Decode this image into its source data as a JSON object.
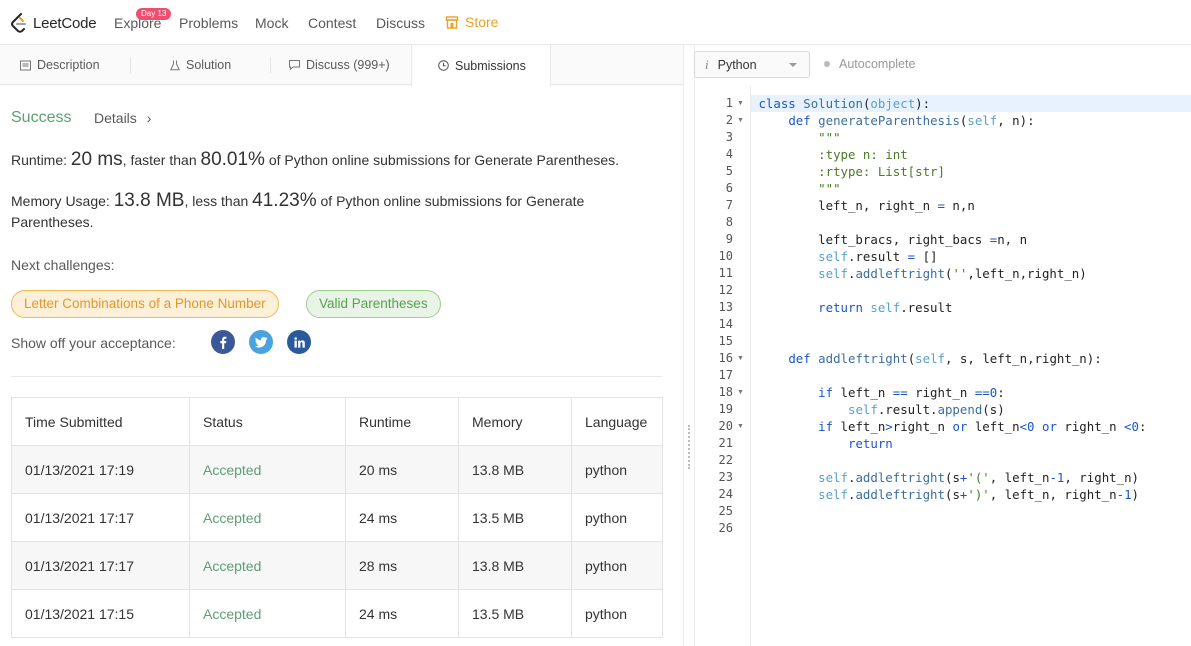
{
  "nav": {
    "logo_text": "LeetCode",
    "items": [
      "Explore",
      "Problems",
      "Mock",
      "Contest",
      "Discuss"
    ],
    "badge": "Day 13",
    "store": "Store"
  },
  "tabs": {
    "description": "Description",
    "solution": "Solution",
    "discuss": "Discuss (999+)",
    "submissions": "Submissions"
  },
  "result": {
    "status": "Success",
    "details": "Details",
    "runtime_label": "Runtime: ",
    "runtime_value": "20 ms",
    "runtime_mid": ", faster than ",
    "runtime_pct": "80.01%",
    "runtime_tail": " of Python online submissions for Generate Parentheses.",
    "memory_label": "Memory Usage: ",
    "memory_value": "13.8 MB",
    "memory_mid": ", less than ",
    "memory_pct": "41.23%",
    "memory_tail": " of Python online submissions for Generate",
    "memory_tail2": "Parentheses."
  },
  "challenges": {
    "label": "Next challenges:",
    "items": [
      "Letter Combinations of a Phone Number",
      "Valid Parentheses"
    ]
  },
  "share": {
    "label": "Show off your acceptance:",
    "icons": [
      "facebook-icon",
      "twitter-icon",
      "linkedin-icon"
    ]
  },
  "table": {
    "headers": [
      "Time Submitted",
      "Status",
      "Runtime",
      "Memory",
      "Language"
    ],
    "rows": [
      [
        "01/13/2021 17:19",
        "Accepted",
        "20 ms",
        "13.8 MB",
        "python"
      ],
      [
        "01/13/2021 17:17",
        "Accepted",
        "24 ms",
        "13.5 MB",
        "python"
      ],
      [
        "01/13/2021 17:17",
        "Accepted",
        "28 ms",
        "13.8 MB",
        "python"
      ],
      [
        "01/13/2021 17:15",
        "Accepted",
        "24 ms",
        "13.5 MB",
        "python"
      ]
    ]
  },
  "editor": {
    "language": "Python",
    "autocomplete": "Autocomplete",
    "lines": [
      "class Solution(object):",
      "    def generateParenthesis(self, n):",
      "        \"\"\"",
      "        :type n: int",
      "        :rtype: List[str]",
      "        \"\"\"",
      "        left_n, right_n = n,n",
      "",
      "        left_bracs, right_bacs =n, n",
      "        self.result = []",
      "        self.addleftright('',left_n,right_n)",
      "",
      "        return self.result",
      "",
      "",
      "    def addleftright(self, s, left_n,right_n):",
      "",
      "        if left_n == right_n ==0:",
      "            self.result.append(s)",
      "        if left_n>right_n or left_n<0 or right_n <0:",
      "            return",
      "",
      "        self.addleftright(s+'(', left_n-1, right_n)",
      "        self.addleftright(s+')', left_n, right_n-1)",
      "",
      ""
    ],
    "line_numbers": [
      "1",
      "2",
      "3",
      "4",
      "5",
      "6",
      "7",
      "8",
      "9",
      "10",
      "11",
      "12",
      "13",
      "14",
      "15",
      "16",
      "17",
      "18",
      "19",
      "20",
      "21",
      "22",
      "23",
      "24",
      "25",
      "26"
    ],
    "fold_lines": [
      1,
      2,
      16,
      18,
      20
    ]
  },
  "colors": {
    "success": "#5b9f73",
    "store": "#f0a020",
    "badge": "#f04e6e",
    "facebook": "#3b5998",
    "twitter": "#4aa3df",
    "linkedin": "#2a5a9c"
  }
}
